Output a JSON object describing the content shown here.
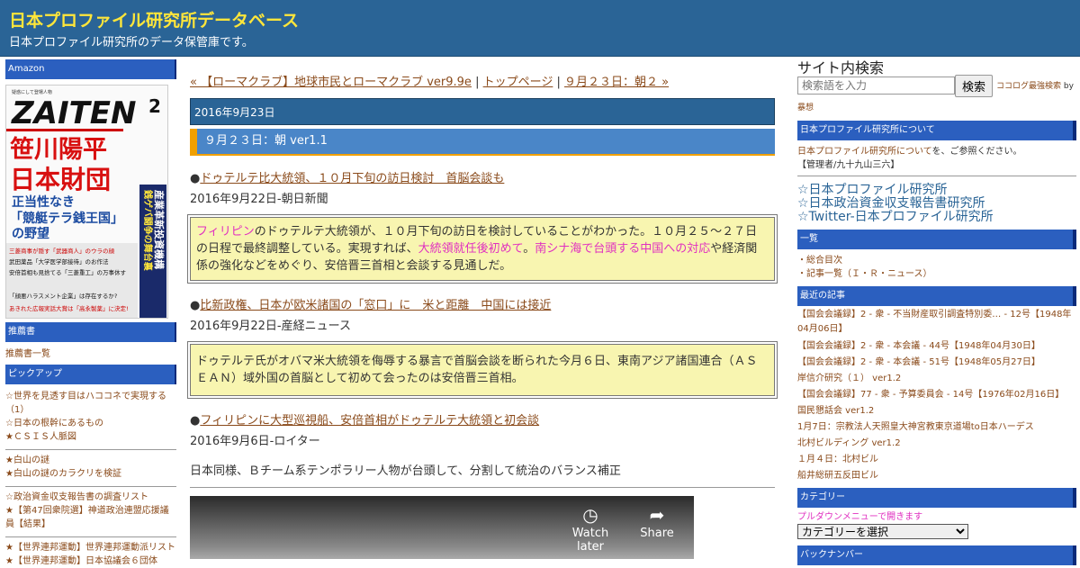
{
  "header": {
    "site_title": "日本プロファイル研究所データベース",
    "site_desc": "日本プロファイル研究所のデータ保管庫です。"
  },
  "left": {
    "amazon_head": "Amazon",
    "magazine": {
      "top_note": "疑惑にして登場人物",
      "mast": "ZAITEN",
      "issue": "2",
      "headline1": "笹川陽平",
      "headline2": "日本財団",
      "sub1": "正当性なき",
      "sub2": "「競艇テラ銭王国」",
      "sub3": "の野望",
      "right_col": "産業革新投資機構",
      "right_col2": "銭ゲバ闘争の舞台裏",
      "lines": [
        "三菱商事が隠す「武器商人」のウラの顔",
        "武田薬品「大学医学部接待」のお作法",
        "安倍首相も見捨てる「三菱重工」の万事休す",
        "「顔悪ハラスメント企業」は存在するか?",
        "あきれた広報実話大賞は「高永製薬」に決定!"
      ]
    },
    "recommend_head": "推薦書",
    "recommend_link": "推薦書一覧",
    "pickup_head": "ピックアップ",
    "pickup_group1": [
      "☆世界を見透す目はハココネで実現する（1）",
      "☆日本の根幹にあるもの",
      "★ＣＳＩＳ人脈図"
    ],
    "pickup_group2": [
      "★白山の謎",
      "★白山の謎のカラクリを検証"
    ],
    "pickup_group3": [
      "☆政治資金収支報告書の調査リスト",
      "★【第47回衆院選】神道政治連盟応援議員【結果】"
    ],
    "pickup_group4": [
      "★【世界連邦運動】世界連邦運動派リスト",
      "★【世界連邦運動】日本協議会６団体"
    ]
  },
  "main": {
    "nav_prev": "« 【ローマクラブ】地球市民とローマクラブ ver9.9e",
    "nav_sep1": " | ",
    "nav_top": "トップページ",
    "nav_sep2": " | ",
    "nav_next": "９月２３日：朝２ »",
    "date": "2016年9月23日",
    "post_title": "９月２３日：朝 ver1.1",
    "articles": [
      {
        "bullet": "●",
        "title": "ドゥテルテ比大統領、１０月下旬の訪日検討　首脳会談も",
        "source": "2016年9月22日-朝日新聞",
        "q1": "フィリピン",
        "q2": "のドゥテルテ大統領が、１０月下旬の訪日を検討していることがわかった。１０月２５～２７日の日程で最終調整している。実現すれば、",
        "q3": "大統領就任後初めて",
        "q4": "。",
        "q5": "南シナ海で台頭する中国への対応",
        "q6": "や経済関係の強化などをめぐり、安倍晋三首相と会談する見通しだ。"
      },
      {
        "bullet": "●",
        "title": "比新政権、日本が欧米諸国の「窓口」に　米と距離　中国には接近",
        "source": "2016年9月22日-産経ニュース",
        "quote": "ドゥテルテ氏がオバマ米大統領を侮辱する暴言で首脳会談を断られた今月６日、東南アジア諸国連合（ＡＳＥＡＮ）域外国の首脳として初めて会ったのは安倍晋三首相。"
      },
      {
        "bullet": "●",
        "title": "フィリピンに大型巡視船、安倍首相がドゥテルテ大統領と初会談",
        "source": "2016年9月6日-ロイター"
      }
    ],
    "comment": "日本同様、Ｂチーム系テンポラリー人物が台頭して、分割して統治のバランス補正",
    "video": {
      "watch_later": "Watch later",
      "share": "Share"
    }
  },
  "right": {
    "search_title": "サイト内検索",
    "search_placeholder": "検索語を入力",
    "search_button": "検索",
    "search_note_link": "ココログ最強検索",
    "search_note_by": " by ",
    "search_author": "暴想",
    "about_head": "日本プロファイル研究所について",
    "about_link": "日本プロファイル研究所について",
    "about_text": "を、ご参照ください。",
    "admin": "【管理者/九十九山三六】",
    "big_links": [
      "☆日本プロファイル研究所",
      "☆日本政治資金収支報告書研究所",
      "☆Twitter-日本プロファイル研究所"
    ],
    "list_head": "一覧",
    "list_items": [
      "・総合目次",
      "・記事一覧（Ｉ・Ｒ・ニュース）"
    ],
    "recent_head": "最近の記事",
    "recent_items": [
      "【国会会議録】2 - 衆 - 不当財産取引調査特別委… - 12号【1948年04月06日】",
      "【国会会議録】2 - 衆 - 本会議 - 44号【1948年04月30日】",
      "【国会会議録】2 - 衆 - 本会議 - 51号【1948年05月27日】",
      "岸信介研究（１） ver1.2",
      "【国会会議録】77 - 衆 - 予算委員会 - 14号【1976年02月16日】",
      "国民懇話会 ver1.2",
      "1月7日：宗教法人天照皇大神宮教東京道場to日本ハーデス",
      "北村ビルディング ver1.2",
      "１月４日：北村ビル",
      "船井総研五反田ビル"
    ],
    "category_head": "カテゴリー",
    "category_note": "プルダウンメニューで開きます",
    "category_select": "カテゴリーを選択",
    "backnumber_head": "バックナンバー"
  },
  "colors": {
    "header_bg": "#2a6496",
    "title_yellow": "#ffe63a",
    "section_blue": "#2b5fbf",
    "quote_bg": "#f8f5b0",
    "highlight": "#e030c0",
    "link": "#8a4a1a"
  }
}
